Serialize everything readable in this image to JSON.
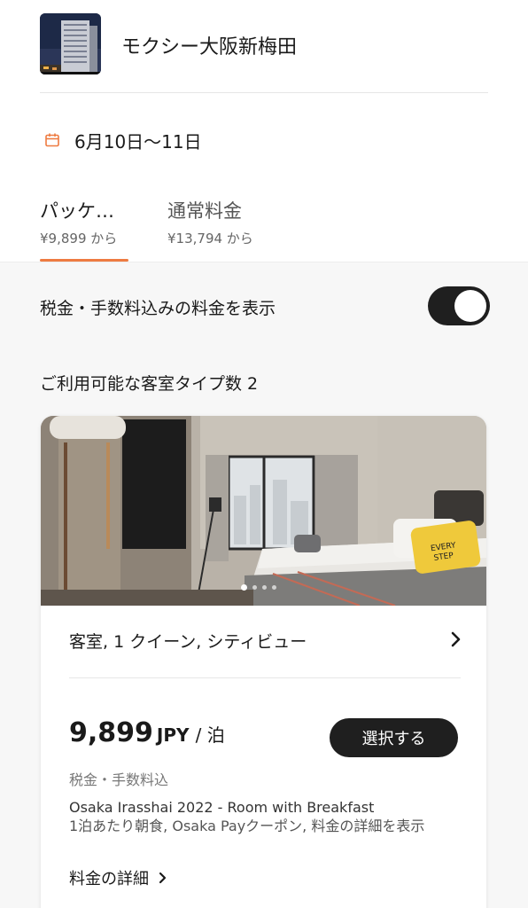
{
  "hotel": {
    "name": "モクシー大阪新梅田"
  },
  "dates": {
    "text": "6月10日〜11日",
    "icon": "calendar-icon",
    "icon_color": "#ee7b41"
  },
  "tabs": [
    {
      "title": "パッケ…",
      "price": "¥9,899 から",
      "active": true
    },
    {
      "title": "通常料金",
      "price": "¥13,794 から",
      "active": false
    }
  ],
  "accent_color": "#ee7b41",
  "tax_toggle": {
    "label": "税金・手数料込みの料金を表示",
    "on": true
  },
  "room_count": {
    "label": "ご利用可能な客室タイプ数 2"
  },
  "room": {
    "title": "客室, 1 クイーン, シティビュー",
    "carousel": {
      "total": 4,
      "active_index": 0
    },
    "price": {
      "amount": "9,899",
      "currency": "JPY",
      "separator": "/ 泊"
    },
    "select_label": "選択する",
    "tax_note": "税金・手数料込",
    "package_name": "Osaka Irasshai 2022 - Room with Breakfast",
    "package_desc": "1泊あたり朝食,  Osaka Payクーポン, 料金の詳細を表示",
    "details_link": "料金の詳細"
  }
}
